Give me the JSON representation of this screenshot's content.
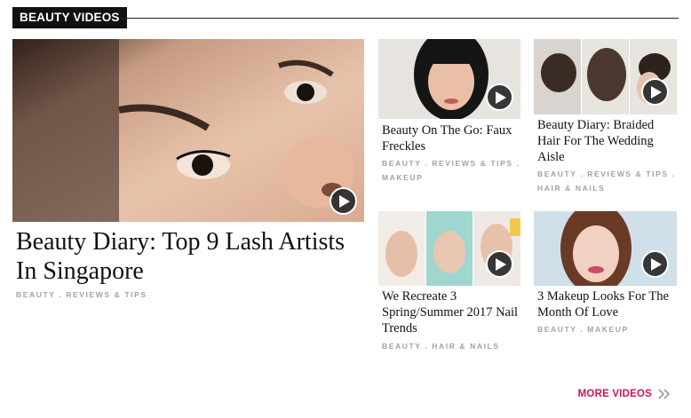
{
  "section": {
    "title": "BEAUTY VIDEOS"
  },
  "featured": {
    "title": "Beauty Diary: Top 9 Lash Artists In Singapore",
    "tags": "BEAUTY . REVIEWS & TIPS"
  },
  "cards": [
    {
      "title": "Beauty On The Go: Faux Freckles",
      "tags": "BEAUTY . REVIEWS & TIPS . MAKEUP"
    },
    {
      "title": "Beauty Diary: Braided Hair For The Wedding Aisle",
      "tags": "BEAUTY . REVIEWS & TIPS . HAIR & NAILS"
    },
    {
      "title": "We Recreate 3 Spring/Summer 2017 Nail Trends",
      "tags": "BEAUTY . HAIR & NAILS"
    },
    {
      "title": "3 Makeup Looks For The Month Of Love",
      "tags": "BEAUTY . MAKEUP"
    }
  ],
  "more": {
    "label": "MORE VIDEOS"
  },
  "colors": {
    "accent": "#c2185b",
    "tag_gray": "#a2a2a2",
    "header_bg": "#111111"
  }
}
